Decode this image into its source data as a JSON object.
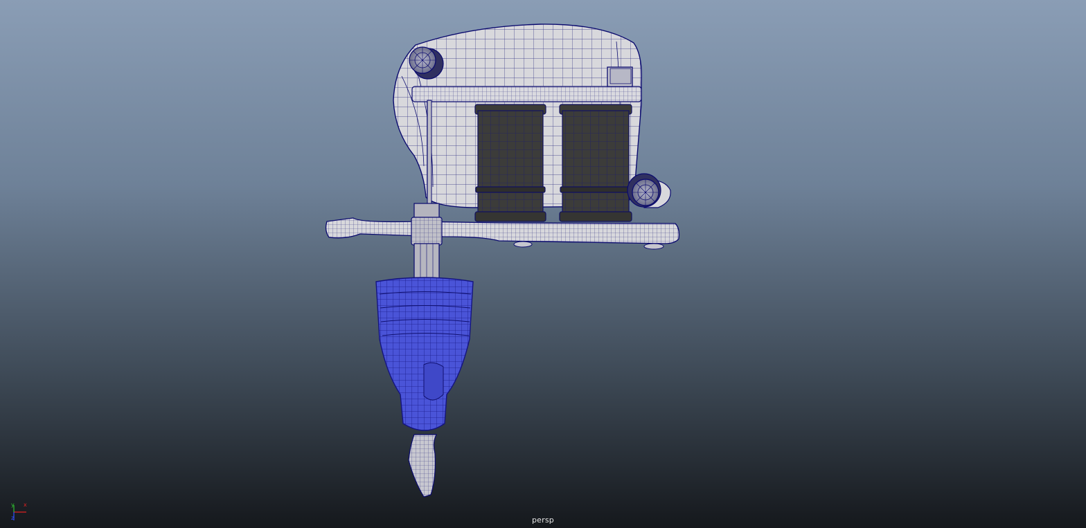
{
  "viewport": {
    "camera_name": "persp",
    "axis": {
      "x_label": "x",
      "y_label": "y",
      "z_label": "z"
    },
    "colors": {
      "shaded_body": "#d8d8dc",
      "wire": "#0a0a6e",
      "coil": "#3c3c3a",
      "grip_selected": "#4a54d8",
      "axis_x": "#e02020",
      "axis_y": "#30c030",
      "axis_z": "#3050ff"
    },
    "icons": {
      "axis_gizmo": "axis-gizmo-icon"
    }
  }
}
